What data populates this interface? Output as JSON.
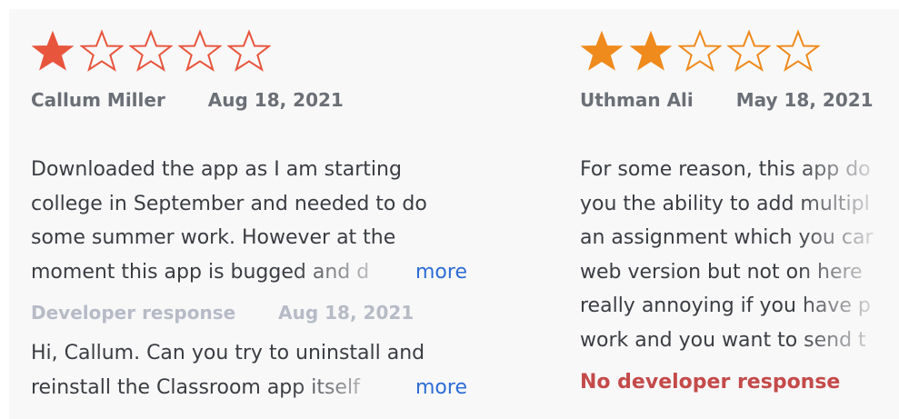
{
  "reviews": [
    {
      "rating": 1,
      "star_color": "#e8553d",
      "author": "Callum Miller",
      "date": "Aug 18, 2021",
      "review_lines": [
        "Downloaded the app as I am starting",
        "college in September and needed to do",
        "some summer work. However at the",
        "moment this app is bugged and d"
      ],
      "more_label": "more",
      "developer_response": {
        "label": "Developer response",
        "date": "Aug 18, 2021",
        "lines": [
          "Hi, Callum. Can you try to uninstall and",
          "reinstall the Classroom app itself"
        ],
        "more_label": "more"
      }
    },
    {
      "rating": 2,
      "star_color": "#ef8a1c",
      "author": "Uthman Ali",
      "date": "May 18, 2021",
      "review_lines": [
        "For some reason, this app do",
        "you the ability to add multipl",
        "an assignment which you car",
        "web version but not on here",
        "really annoying if you have p",
        "work and you want to send t"
      ],
      "no_developer_response": "No developer response",
      "no_developer_color": "#c54a4a"
    }
  ]
}
